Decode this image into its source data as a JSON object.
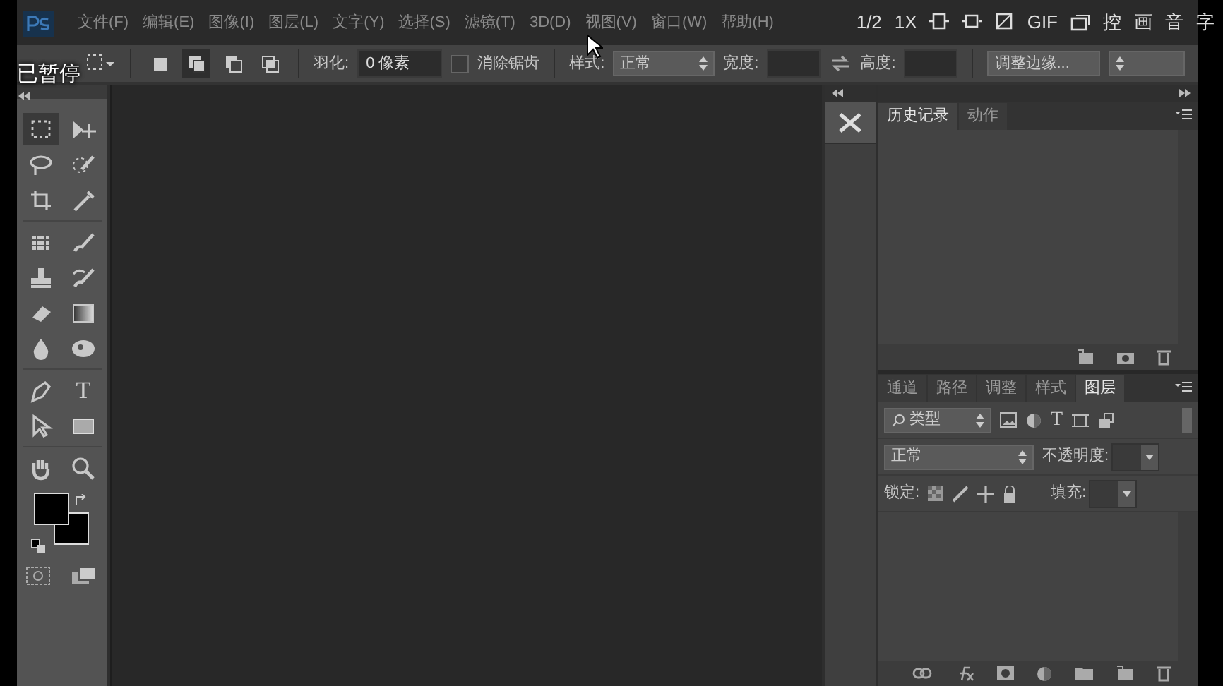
{
  "menu": [
    "文件(F)",
    "编辑(E)",
    "图像(I)",
    "图层(L)",
    "文字(Y)",
    "选择(S)",
    "滤镜(T)",
    "3D(D)",
    "视图(V)",
    "窗口(W)",
    "帮助(H)"
  ],
  "options_bar": {
    "selection_modes": [
      {
        "selected": false
      },
      {
        "selected": true
      },
      {
        "selected": false
      },
      {
        "selected": false
      }
    ],
    "feather_label": "羽化:",
    "feather_value": "0 像素",
    "antialias": {
      "label": "消除锯齿",
      "checked": false
    },
    "style_label": "样式:",
    "style_value": "正常",
    "width_label": "宽度:",
    "height_label": "高度:",
    "refine_edge": "调整边缘..."
  },
  "tools": [
    {
      "kind": "marquee",
      "selected": true
    },
    {
      "kind": "move",
      "selected": false
    },
    {
      "kind": "lasso",
      "selected": false
    },
    {
      "kind": "quick-select",
      "selected": false
    },
    {
      "kind": "crop",
      "selected": false
    },
    {
      "kind": "eyedropper",
      "selected": false
    },
    {
      "kind": "healing",
      "selected": false
    },
    {
      "kind": "brush",
      "selected": false
    },
    {
      "kind": "stamp",
      "selected": false
    },
    {
      "kind": "history-brush",
      "selected": false
    },
    {
      "kind": "eraser",
      "selected": false
    },
    {
      "kind": "gradient",
      "selected": false
    },
    {
      "kind": "drop",
      "selected": false
    },
    {
      "kind": "dodge",
      "selected": false
    },
    {
      "kind": "pen",
      "selected": false
    },
    {
      "kind": "type",
      "label": "T",
      "selected": false
    },
    {
      "kind": "path-select",
      "selected": false
    },
    {
      "kind": "rectangle",
      "selected": false
    },
    {
      "kind": "hand",
      "selected": false
    },
    {
      "kind": "zoom",
      "selected": false
    }
  ],
  "history_panel": {
    "tabs": [
      {
        "label": "历史记录",
        "selected": true
      },
      {
        "label": "动作",
        "selected": false
      }
    ]
  },
  "layers_panel": {
    "tabs": [
      {
        "label": "通道",
        "selected": false
      },
      {
        "label": "路径",
        "selected": false
      },
      {
        "label": "调整",
        "selected": false
      },
      {
        "label": "样式",
        "selected": false
      },
      {
        "label": "图层",
        "selected": true
      }
    ],
    "filter": "类型",
    "filter_type_label": "T",
    "blend_mode": "正常",
    "opacity_label": "不透明度:",
    "lock_label": "锁定:",
    "fill_label": "填充:"
  },
  "player": {
    "status": "已暂停",
    "controls": [
      {
        "kind": "text",
        "label": "1/2"
      },
      {
        "kind": "text",
        "label": "1X"
      },
      {
        "kind": "icon"
      },
      {
        "kind": "icon"
      },
      {
        "kind": "icon"
      },
      {
        "kind": "text",
        "label": "GIF"
      },
      {
        "kind": "icon"
      },
      {
        "kind": "text",
        "label": "控"
      },
      {
        "kind": "text",
        "label": "画"
      },
      {
        "kind": "text",
        "label": "音"
      },
      {
        "kind": "text",
        "label": "字"
      }
    ]
  }
}
